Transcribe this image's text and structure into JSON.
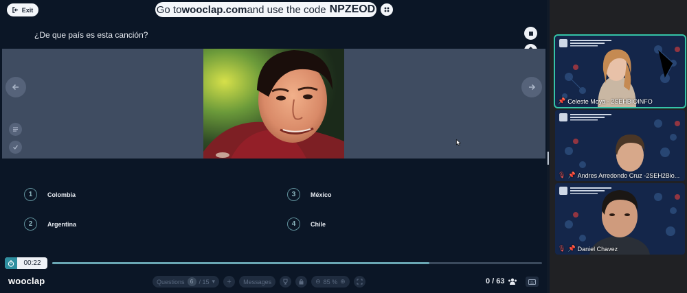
{
  "header": {
    "exit_label": "Exit",
    "banner_prefix": "Go to ",
    "banner_site": "wooclap.com",
    "banner_middle": " and use the code ",
    "banner_code": "NPZEOD"
  },
  "question": {
    "text": "¿De que país es esta canción?"
  },
  "answers": [
    {
      "num": "1",
      "label": "Colombia"
    },
    {
      "num": "2",
      "label": "Argentina"
    },
    {
      "num": "3",
      "label": "México"
    },
    {
      "num": "4",
      "label": "Chile"
    }
  ],
  "timer": {
    "value": "00:22",
    "progress_fraction": 0.77
  },
  "footer": {
    "logo": "wooclap",
    "questions_label": "Questions",
    "question_current": "6",
    "question_total": "/ 15",
    "messages_label": "Messages",
    "zoom": "85 %",
    "participants": "0 / 63"
  },
  "participants": [
    {
      "name": "Celeste Moya - 2SEHBIOINFO",
      "active": true
    },
    {
      "name": "Andres Arredondo Cruz -2SEH2Bio...",
      "active": false
    },
    {
      "name": "Daniel Chavez",
      "active": false
    }
  ],
  "colors": {
    "background": "#0b1626",
    "media_strip": "#3f4c61",
    "accent_teal": "#35c4a7",
    "timer_teal": "#2f8fa0",
    "video_bg": "#13213f"
  },
  "icons": {
    "exit": "exit-icon",
    "menu": "grid-menu-icon",
    "stop": "stop-icon",
    "move": "vertical-arrows-icon",
    "calculator": "calculator-icon",
    "prev": "arrow-left-icon",
    "next": "arrow-right-icon",
    "results": "list-icon",
    "correct": "check-icon",
    "timer": "stopwatch-icon",
    "participants": "people-icon",
    "keyboard": "keyboard-icon",
    "pin": "pin-icon",
    "mic_off": "mic-off-icon"
  }
}
